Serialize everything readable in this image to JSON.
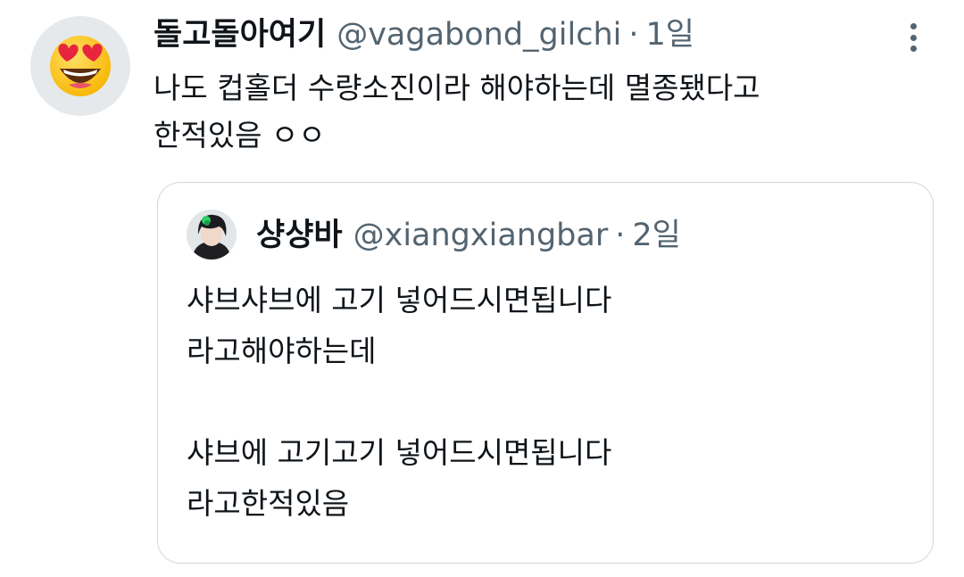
{
  "tweet": {
    "avatar_icon": "heart-eyes-emoji-icon",
    "display_name": "돌고돌아여기",
    "handle": "@vagabond_gilchi",
    "separator": "·",
    "time": "1일",
    "more_icon": "more-vertical-icon",
    "text_lines": [
      "나도 컵홀더 수량소진이라 해야하는데 멸종됐다고",
      "한적있음 ㅇㅇ"
    ]
  },
  "quoted_tweet": {
    "display_name": "샹샹바",
    "handle": "@xiangxiangbar",
    "separator": "·",
    "time": "2일",
    "text_lines": [
      "샤브샤브에 고기 넣어드시면됩니다",
      "라고해야하는데",
      "",
      "샤브에 고기고기 넣어드시면됩니다",
      "라고한적있음"
    ]
  },
  "colors": {
    "text_primary": "#0f1419",
    "text_secondary": "#536471",
    "border": "#cfd9de",
    "avatar_bg": "#e6e9ec"
  }
}
